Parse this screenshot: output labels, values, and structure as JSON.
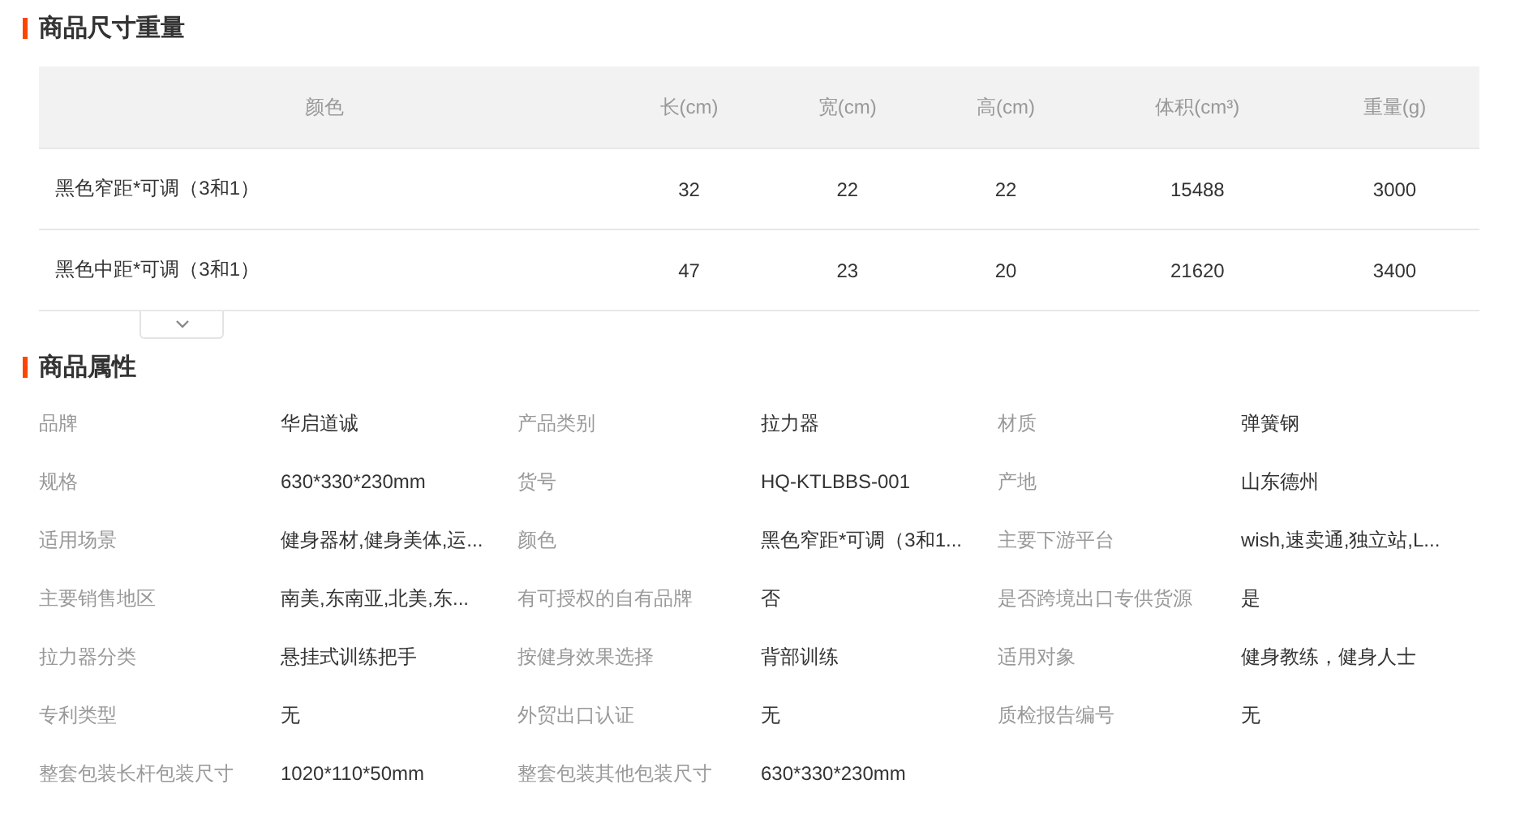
{
  "size_section": {
    "title": "商品尺寸重量",
    "table": {
      "columns": [
        "颜色",
        "长(cm)",
        "宽(cm)",
        "高(cm)",
        "体积(cm³)",
        "重量(g)"
      ],
      "rows": [
        [
          "黑色窄距*可调（3和1）",
          "32",
          "22",
          "22",
          "15488",
          "3000"
        ],
        [
          "黑色中距*可调（3和1）",
          "47",
          "23",
          "20",
          "21620",
          "3400"
        ]
      ]
    },
    "expand_button": {
      "expanded": false
    }
  },
  "attributes_section": {
    "title": "商品属性",
    "attributes": [
      {
        "label": "品牌",
        "value": "华启道诚"
      },
      {
        "label": "产品类别",
        "value": "拉力器"
      },
      {
        "label": "材质",
        "value": "弹簧钢"
      },
      {
        "label": "规格",
        "value": "630*330*230mm"
      },
      {
        "label": "货号",
        "value": "HQ-KTLBBS-001"
      },
      {
        "label": "产地",
        "value": "山东德州"
      },
      {
        "label": "适用场景",
        "value": "健身器材,健身美体,运..."
      },
      {
        "label": "颜色",
        "value": "黑色窄距*可调（3和1..."
      },
      {
        "label": "主要下游平台",
        "value": "wish,速卖通,独立站,L..."
      },
      {
        "label": "主要销售地区",
        "value": "南美,东南亚,北美,东..."
      },
      {
        "label": "有可授权的自有品牌",
        "value": "否"
      },
      {
        "label": "是否跨境出口专供货源",
        "value": "是"
      },
      {
        "label": "拉力器分类",
        "value": "悬挂式训练把手"
      },
      {
        "label": "按健身效果选择",
        "value": "背部训练"
      },
      {
        "label": "适用对象",
        "value": "健身教练，健身人士"
      },
      {
        "label": "专利类型",
        "value": "无"
      },
      {
        "label": "外贸出口认证",
        "value": "无"
      },
      {
        "label": "质检报告编号",
        "value": "无"
      },
      {
        "label": "整套包装长杆包装尺寸",
        "value": "1020*110*50mm"
      },
      {
        "label": "整套包装其他包装尺寸",
        "value": "630*330*230mm"
      }
    ]
  }
}
